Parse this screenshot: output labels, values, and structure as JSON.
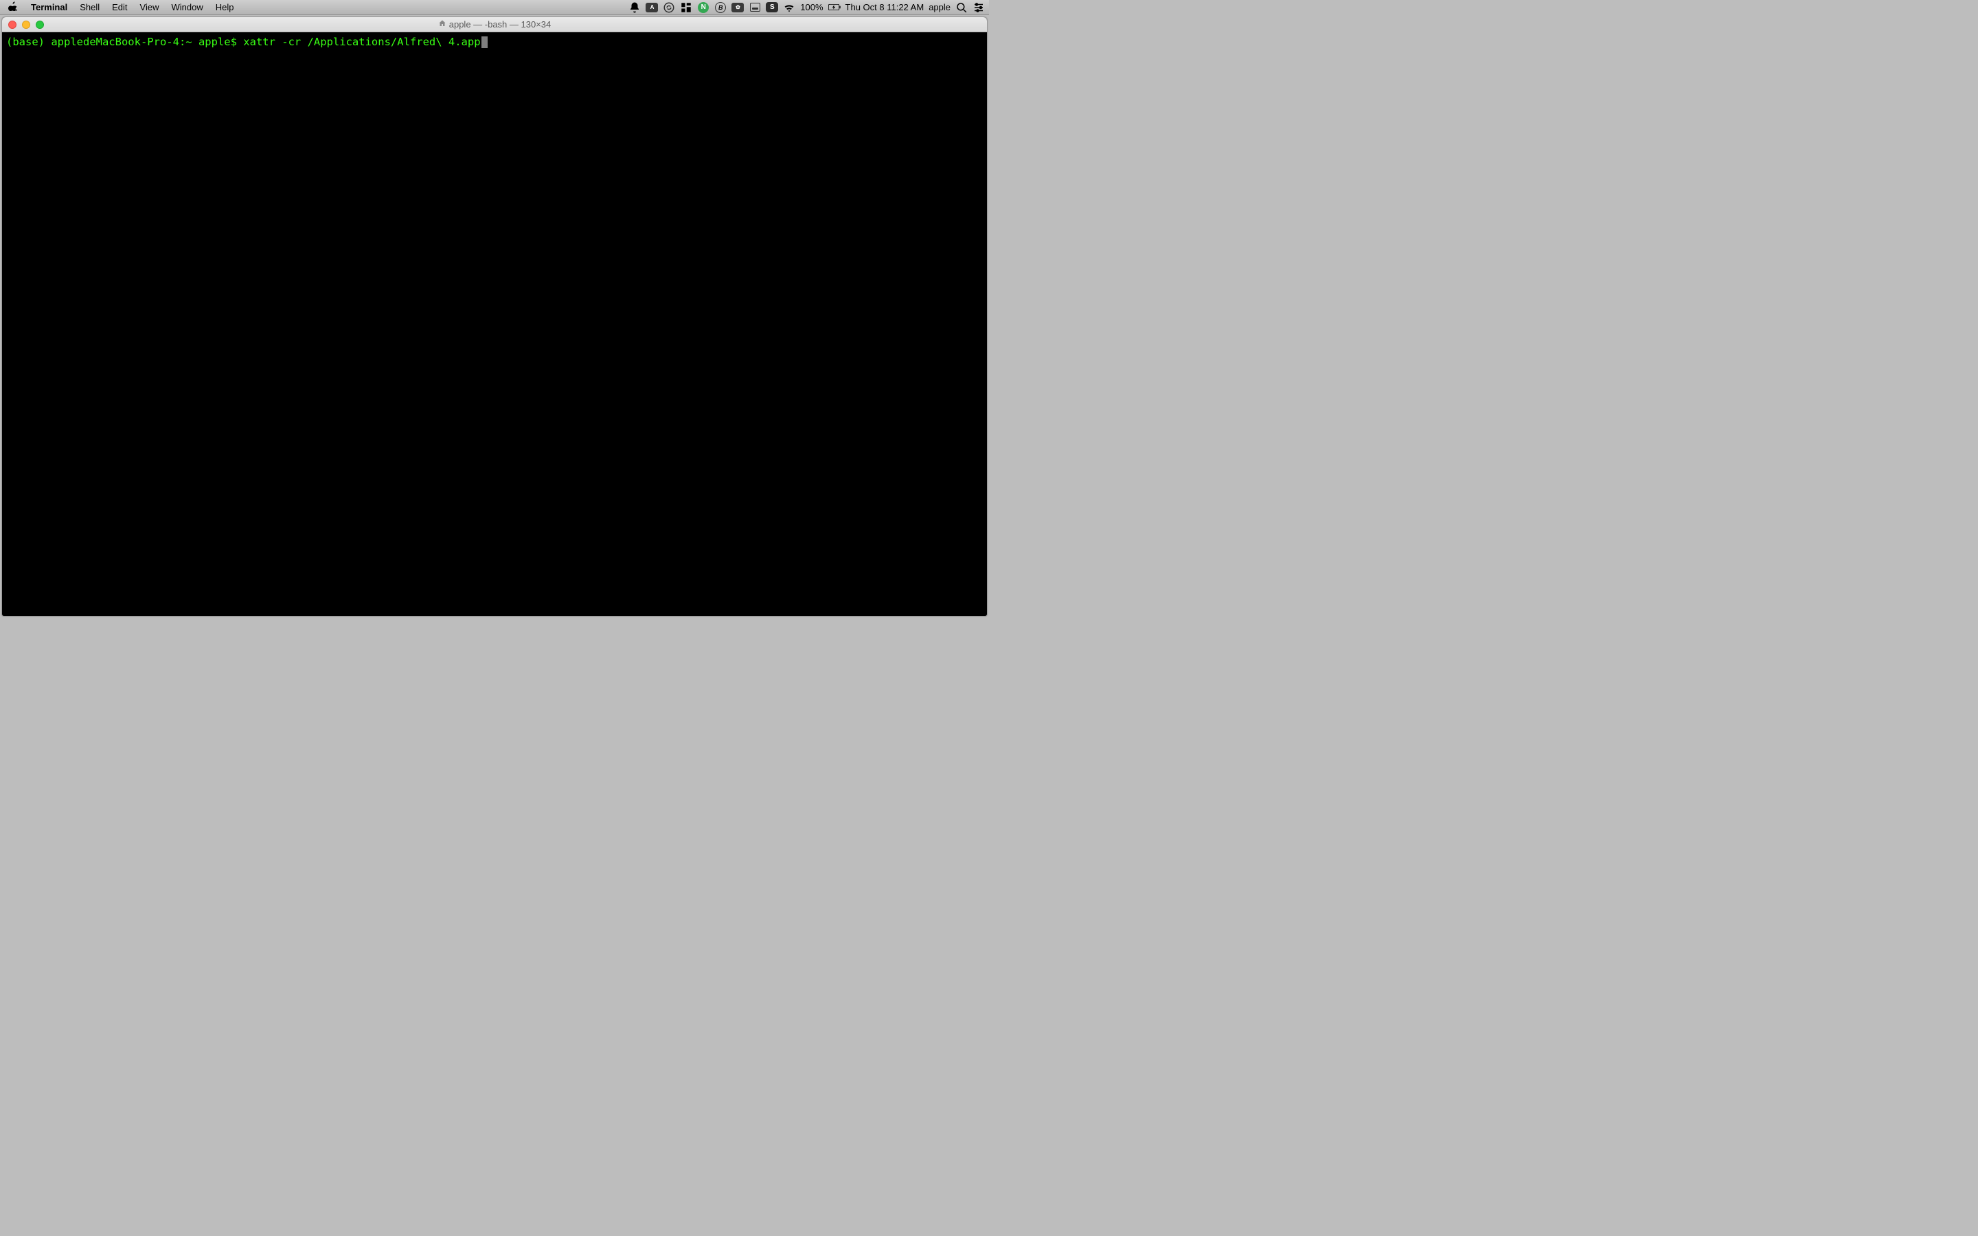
{
  "menubar": {
    "app_name": "Terminal",
    "items": [
      "Shell",
      "Edit",
      "View",
      "Window",
      "Help"
    ],
    "status": {
      "battery_pct": "100%",
      "datetime": "Thu Oct 8  11:22 AM",
      "user": "apple"
    },
    "tray_letters": {
      "n": "N",
      "b": "B",
      "input": "A",
      "sogou": "S"
    }
  },
  "window": {
    "title": "apple — -bash — 130×34"
  },
  "terminal": {
    "prompt": "(base) appledeMacBook-Pro-4:~ apple$ ",
    "command": "xattr -cr /Applications/Alfred\\ 4.app"
  }
}
